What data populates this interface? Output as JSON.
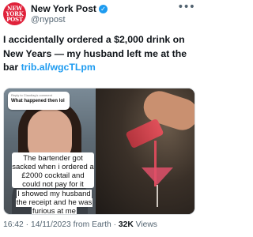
{
  "account": {
    "display_name": "New York Post",
    "handle": "@nypost",
    "avatar_line1": "NEW",
    "avatar_line2": "YORK",
    "avatar_line3": "POST"
  },
  "tweet": {
    "text_main": "I accidentally ordered a $2,000 drink on New Years — my husband left me at the bar ",
    "link": "trib.al/wgcTLpm"
  },
  "media": {
    "reply_meta": "Reply to Claudiag's comment",
    "reply_text": "What happened then lol",
    "caption_1": "The bartender got sacked when i ordered a £2000 cocktail and could not pay for it",
    "caption_2": "I showed my husband the receipt and he was furious at me"
  },
  "footer": {
    "time": "16:42",
    "date": "14/11/2023",
    "source": "from Earth",
    "views_count": "32K",
    "views_label": "Views",
    "sep": "·"
  },
  "icons": {
    "verified": "verified-badge-icon",
    "more": "more-options-icon"
  },
  "colors": {
    "brand": "#e0213a",
    "link": "#1d9bf0",
    "muted": "#536471"
  }
}
